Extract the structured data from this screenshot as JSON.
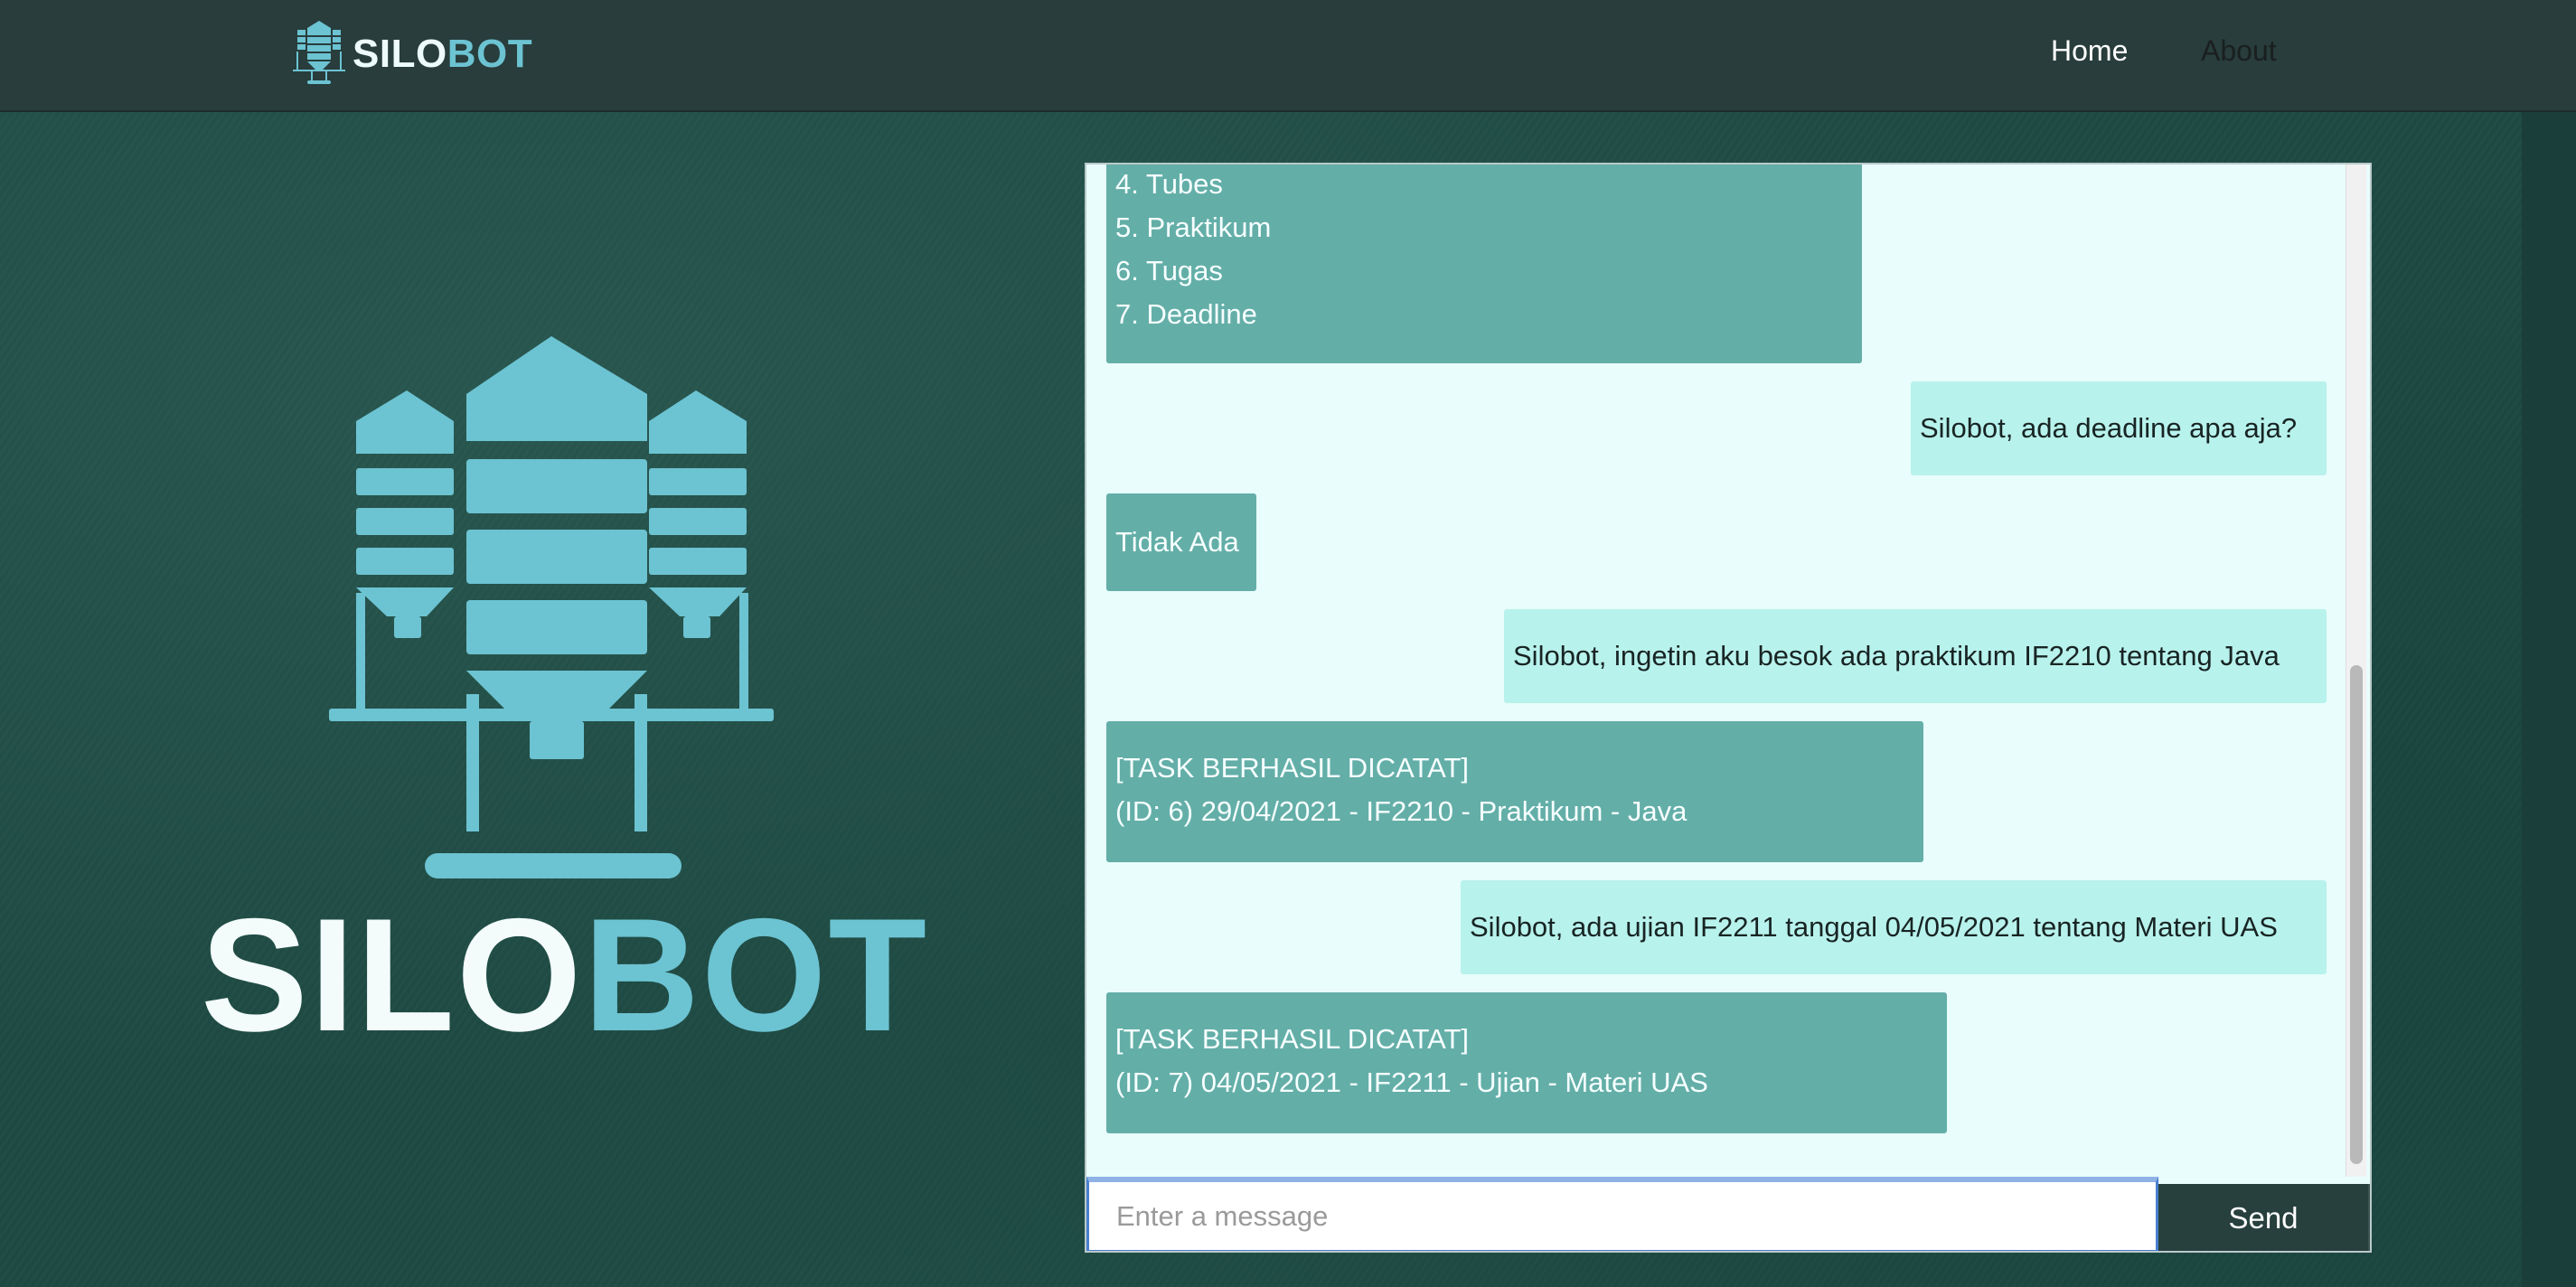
{
  "nav": {
    "brand_white": "SILO",
    "brand_blue": "BOT",
    "links": [
      "Home",
      "About"
    ]
  },
  "hero": {
    "title_white": "SILO",
    "title_blue": "BOT"
  },
  "chat": {
    "messages": [
      {
        "sender": "bot",
        "lines": [
          "4. Tubes",
          "5. Praktikum",
          "6. Tugas",
          "7. Deadline"
        ]
      },
      {
        "sender": "user",
        "lines": [
          "Silobot, ada deadline apa aja?"
        ]
      },
      {
        "sender": "bot",
        "lines": [
          "Tidak Ada"
        ]
      },
      {
        "sender": "user",
        "lines": [
          "Silobot, ingetin aku besok ada praktikum IF2210 tentang Java"
        ]
      },
      {
        "sender": "bot",
        "lines": [
          "[TASK BERHASIL DICATAT]",
          "(ID: 6) 29/04/2021 - IF2210 - Praktikum - Java"
        ]
      },
      {
        "sender": "user",
        "lines": [
          "Silobot, ada ujian IF2211 tanggal 04/05/2021 tentang Materi UAS"
        ]
      },
      {
        "sender": "bot",
        "lines": [
          "[TASK BERHASIL DICATAT]",
          "(ID: 7) 04/05/2021 - IF2211 - Ujian - Materi UAS"
        ]
      }
    ],
    "input_placeholder": "Enter a message",
    "input_value": "",
    "send_label": "Send"
  },
  "colors": {
    "navbar": "#283d3c",
    "background": "#1e4a43",
    "accent_blue": "#6cc3d2",
    "bot_bubble": "#64aea8",
    "user_bubble": "#b8f2ec",
    "chat_bg": "#e8fdfc",
    "send_button": "#27403e"
  },
  "icons": {
    "brand_logo": "silo-icon",
    "hero_logo": "silo-icon"
  }
}
